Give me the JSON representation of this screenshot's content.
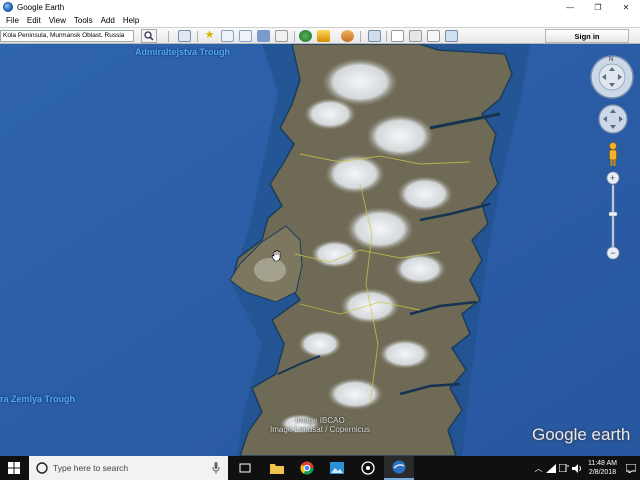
{
  "window": {
    "title": "Google Earth",
    "controls": [
      "—",
      "❐",
      "✕"
    ]
  },
  "menu": [
    "File",
    "Edit",
    "View",
    "Tools",
    "Add",
    "Help"
  ],
  "toolbar": {
    "search_value": "Kola Peninsula, Murmansk Oblast, Russia",
    "signin_label": "Sign in"
  },
  "map": {
    "labels": {
      "trough_top": "Admiraltejstva Trough",
      "trough_left": "ra Zemlya Trough"
    },
    "credits": [
      "Image IBCAO",
      "Image Landsat / Copernicus"
    ],
    "logo": "Google earth"
  },
  "taskbar": {
    "search_placeholder": "Type here to search",
    "time": "11:48 AM",
    "date": "2/8/2018"
  },
  "colors": {
    "ocean": "#2b5faa",
    "land": "#6f6a55",
    "snow": "#e9ecef",
    "label": "#4ea8ff",
    "taskbar": "#101010"
  }
}
